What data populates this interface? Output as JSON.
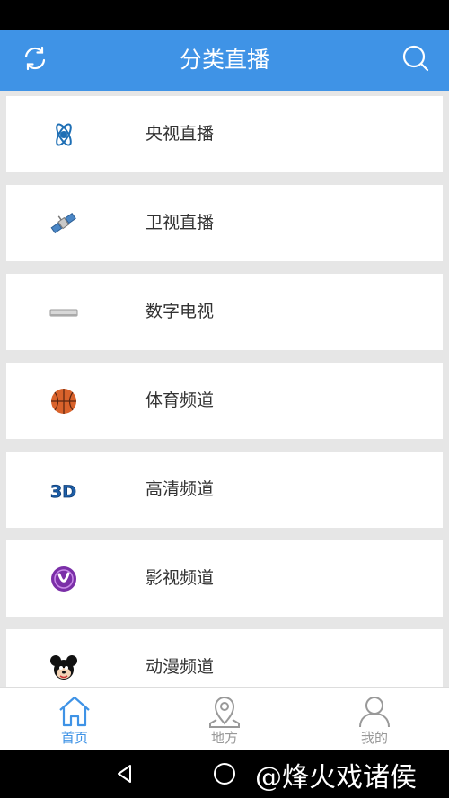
{
  "header": {
    "title": "分类直播",
    "refresh_icon": "refresh-icon",
    "search_icon": "search-icon"
  },
  "categories": [
    {
      "label": "央视直播",
      "icon": "atom-icon"
    },
    {
      "label": "卫视直播",
      "icon": "satellite-icon"
    },
    {
      "label": "数字电视",
      "icon": "set-top-box-icon"
    },
    {
      "label": "体育频道",
      "icon": "basketball-icon"
    },
    {
      "label": "高清频道",
      "icon": "3d-icon"
    },
    {
      "label": "影视频道",
      "icon": "film-icon"
    },
    {
      "label": "动漫频道",
      "icon": "mickey-icon"
    }
  ],
  "bottom_nav": [
    {
      "label": "首页",
      "icon": "home-icon",
      "active": true
    },
    {
      "label": "地方",
      "icon": "location-icon",
      "active": false
    },
    {
      "label": "我的",
      "icon": "user-icon",
      "active": false
    }
  ],
  "watermark": "@烽火戏诸侯",
  "colors": {
    "primary": "#3f93e6",
    "background": "#e6e6e6",
    "inactive": "#999999"
  }
}
